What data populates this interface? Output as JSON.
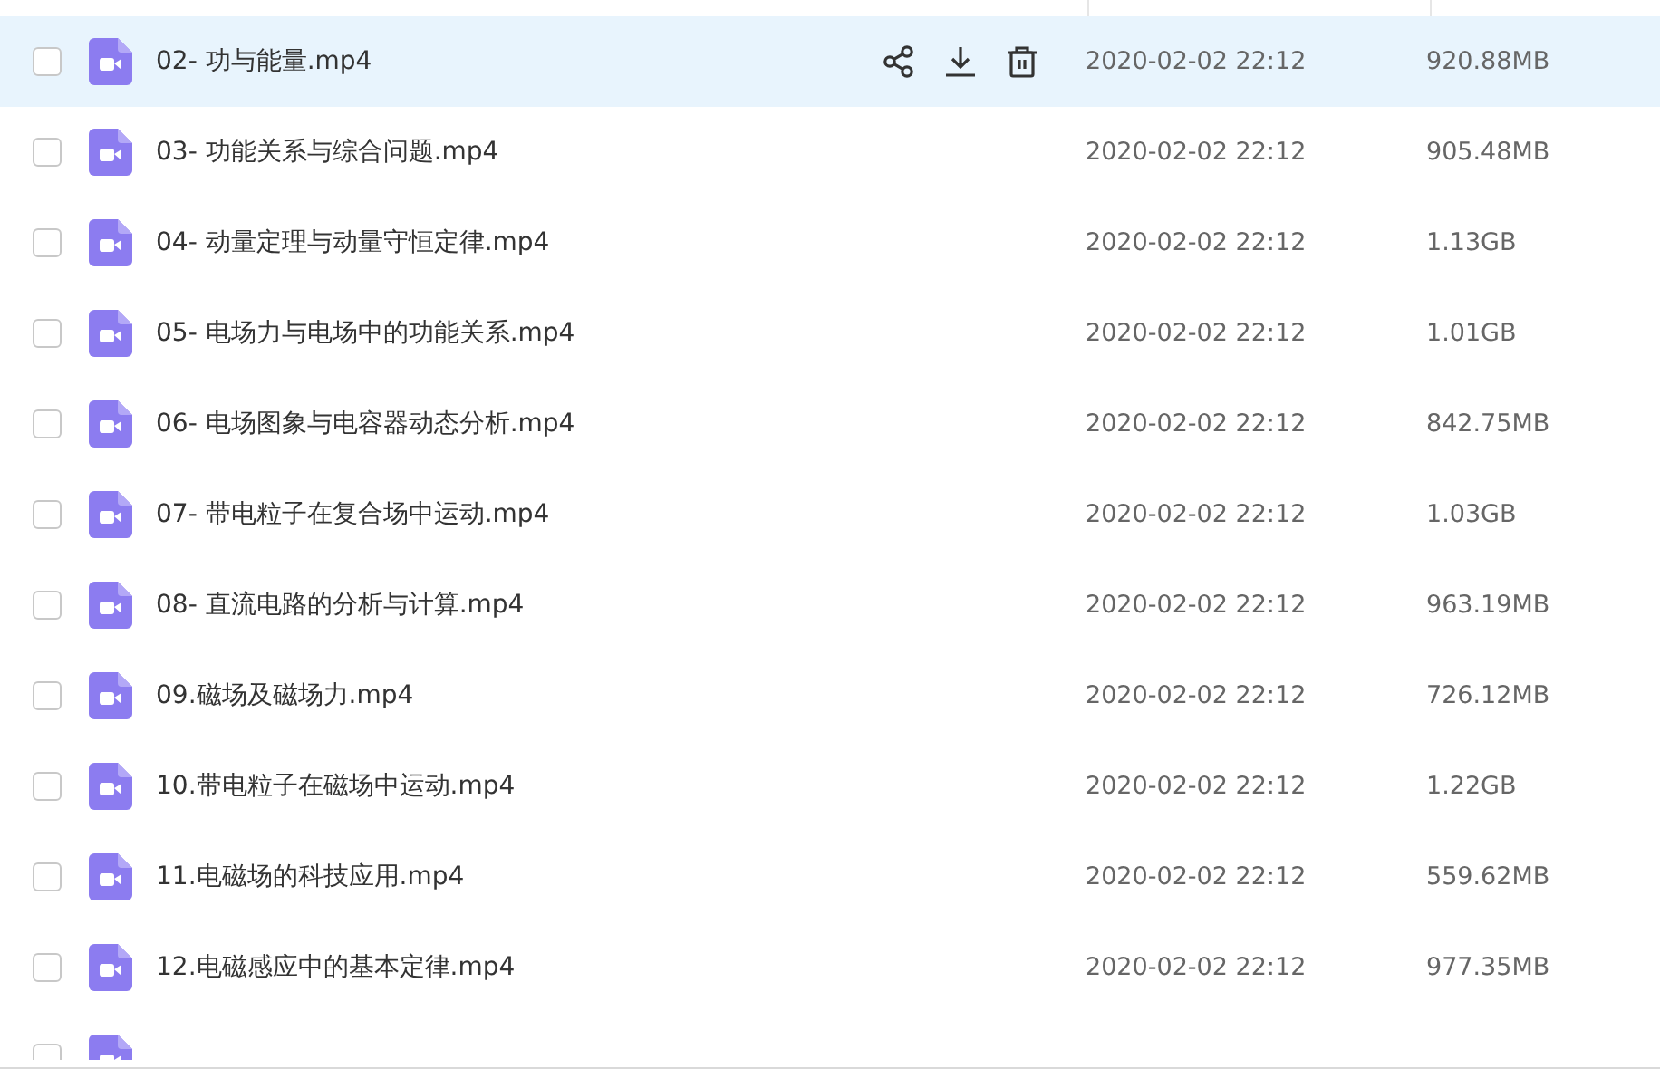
{
  "files": [
    {
      "name": "02- 功与能量.mp4",
      "date": "2020-02-02 22:12",
      "size": "920.88MB",
      "checked": false,
      "highlighted": true
    },
    {
      "name": "03- 功能关系与综合问题.mp4",
      "date": "2020-02-02 22:12",
      "size": "905.48MB",
      "checked": false,
      "highlighted": false
    },
    {
      "name": "04- 动量定理与动量守恒定律.mp4",
      "date": "2020-02-02 22:12",
      "size": "1.13GB",
      "checked": false,
      "highlighted": false
    },
    {
      "name": "05- 电场力与电场中的功能关系.mp4",
      "date": "2020-02-02 22:12",
      "size": "1.01GB",
      "checked": false,
      "highlighted": false
    },
    {
      "name": "06- 电场图象与电容器动态分析.mp4",
      "date": "2020-02-02 22:12",
      "size": "842.75MB",
      "checked": false,
      "highlighted": false
    },
    {
      "name": "07- 带电粒子在复合场中运动.mp4",
      "date": "2020-02-02 22:12",
      "size": "1.03GB",
      "checked": false,
      "highlighted": false
    },
    {
      "name": "08- 直流电路的分析与计算.mp4",
      "date": "2020-02-02 22:12",
      "size": "963.19MB",
      "checked": false,
      "highlighted": false
    },
    {
      "name": "09.磁场及磁场力.mp4",
      "date": "2020-02-02 22:12",
      "size": "726.12MB",
      "checked": false,
      "highlighted": false
    },
    {
      "name": "10.带电粒子在磁场中运动.mp4",
      "date": "2020-02-02 22:12",
      "size": "1.22GB",
      "checked": false,
      "highlighted": false
    },
    {
      "name": "11.电磁场的科技应用.mp4",
      "date": "2020-02-02 22:12",
      "size": "559.62MB",
      "checked": false,
      "highlighted": false
    },
    {
      "name": "12.电磁感应中的基本定律.mp4",
      "date": "2020-02-02 22:12",
      "size": "977.35MB",
      "checked": false,
      "highlighted": false
    },
    {
      "checked": false,
      "highlighted": false
    }
  ]
}
